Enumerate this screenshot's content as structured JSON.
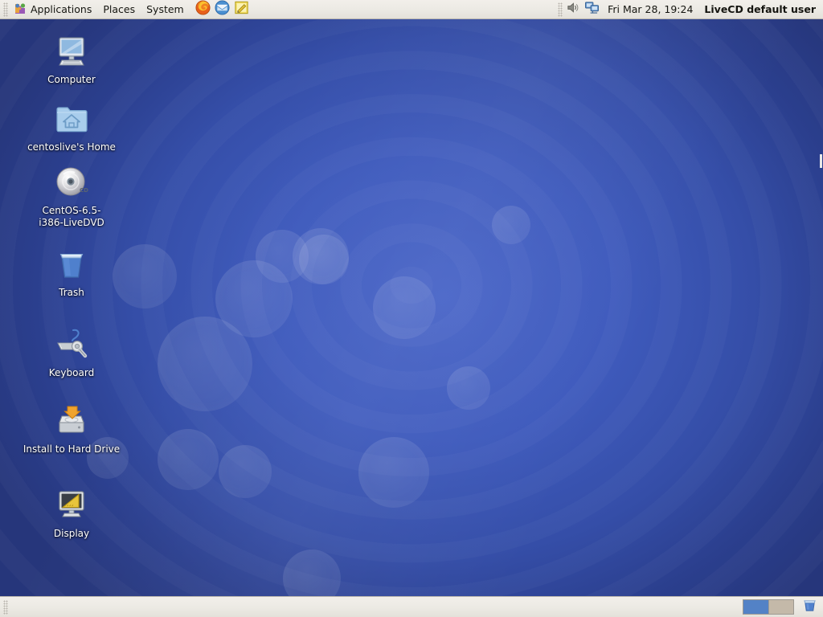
{
  "desktop": {
    "wallpaper_base_color": "#3b57b5",
    "wallpaper_edge_color": "#26367b",
    "icons": [
      {
        "label": "Computer",
        "icon": "computer-icon"
      },
      {
        "label": "centoslive's Home",
        "icon": "home-folder-icon"
      },
      {
        "label": "CentOS-6.5-i386-LiveDVD",
        "icon": "cd-disc-icon"
      },
      {
        "label": "Trash",
        "icon": "trash-icon"
      },
      {
        "label": "Keyboard",
        "icon": "keyboard-settings-icon"
      },
      {
        "label": "Install to Hard Drive",
        "icon": "hard-drive-install-icon"
      },
      {
        "label": "Display",
        "icon": "display-settings-icon"
      }
    ]
  },
  "top_panel": {
    "background_color": "#eceae4",
    "menus": [
      {
        "label": "Applications",
        "icon": "centos-applications-icon"
      },
      {
        "label": "Places"
      },
      {
        "label": "System"
      }
    ],
    "launchers": [
      {
        "name": "firefox-icon",
        "title": "Firefox Web Browser"
      },
      {
        "name": "thunderbird-icon",
        "title": "Thunderbird Mail"
      },
      {
        "name": "text-editor-icon",
        "title": "Text Editor"
      }
    ],
    "tray": [
      {
        "name": "volume-icon",
        "title": "Volume"
      },
      {
        "name": "network-display-icon",
        "title": "Network / Displays"
      }
    ],
    "clock": "Fri Mar 28, 19:24",
    "username": "LiveCD default user"
  },
  "bottom_panel": {
    "background_color": "#eceae4",
    "workspaces": [
      {
        "name": "workspace-1",
        "active": true,
        "color": "#5382c6"
      },
      {
        "name": "workspace-2",
        "active": false,
        "color": "#c4b9a9"
      }
    ],
    "trash_applet": {
      "name": "trash-applet-icon",
      "title": "Trash"
    }
  }
}
